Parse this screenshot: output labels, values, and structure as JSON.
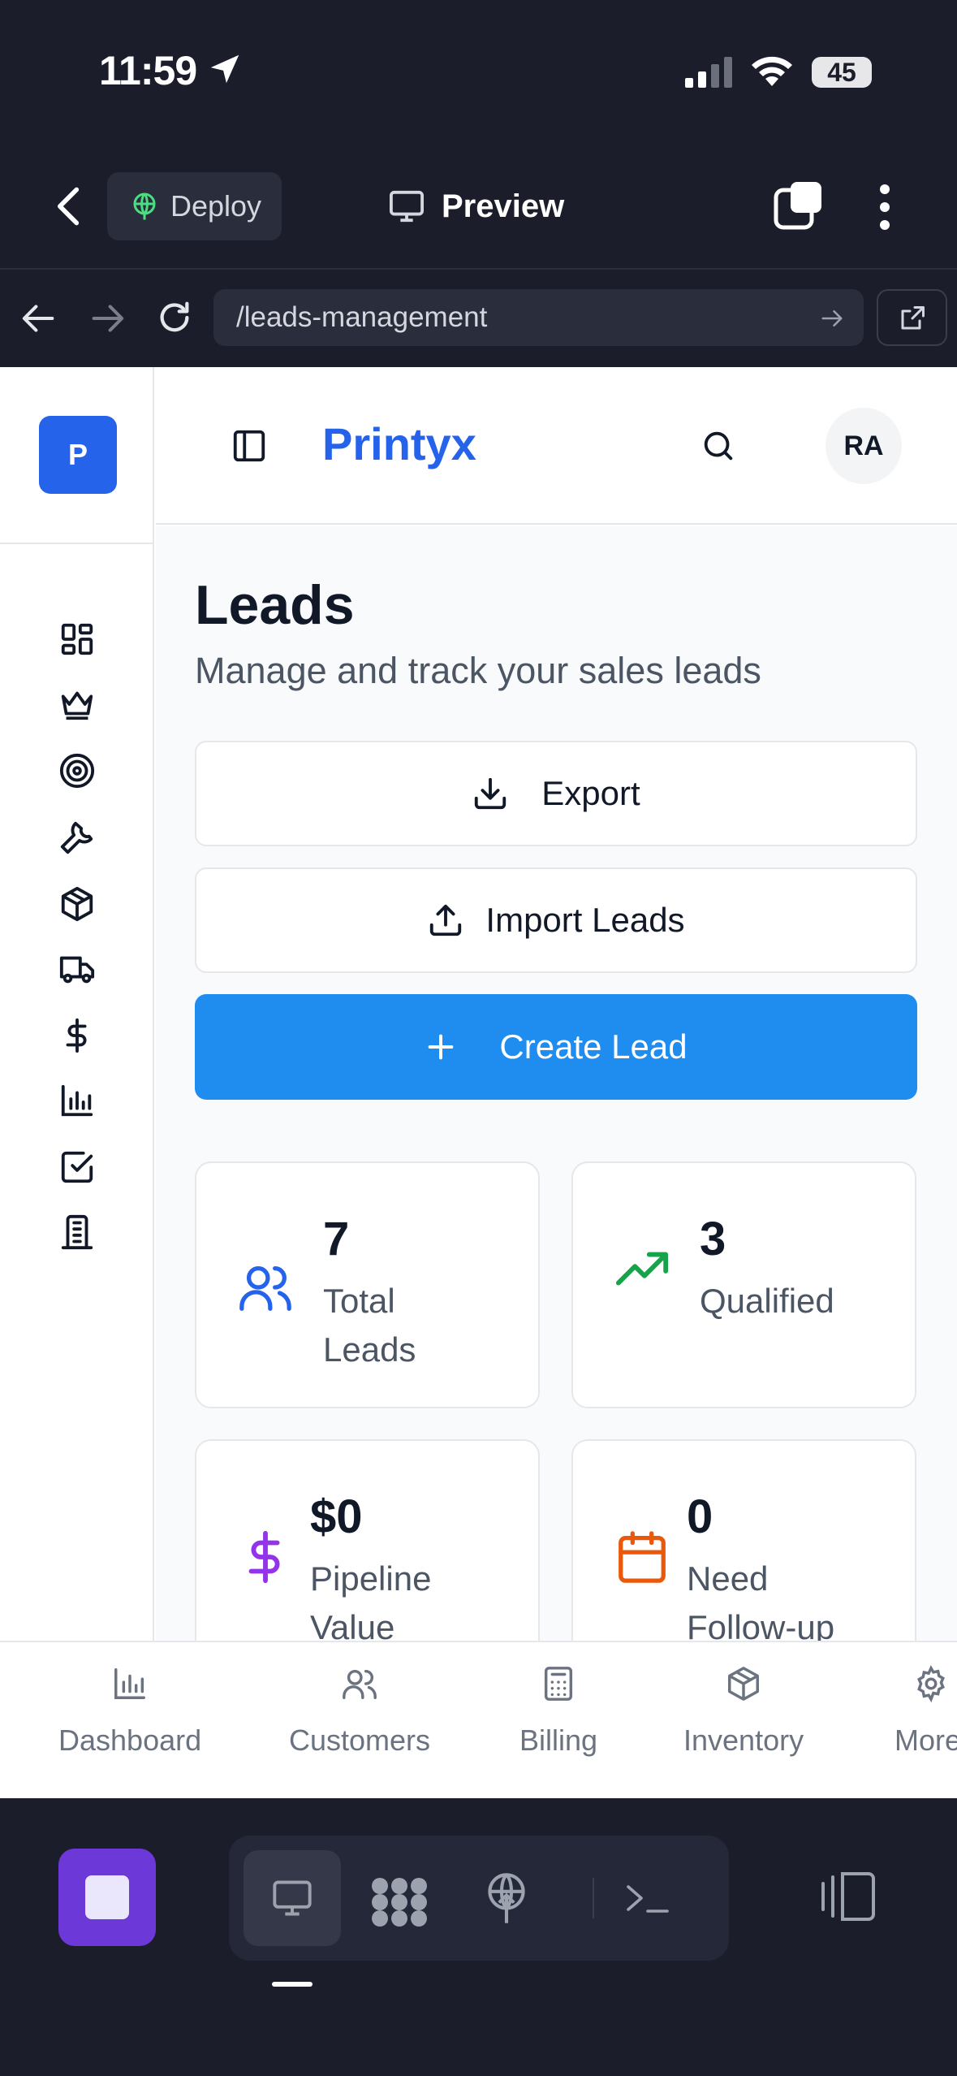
{
  "status_bar": {
    "time": "11:59",
    "battery": "45"
  },
  "app_header": {
    "deploy_label": "Deploy",
    "preview_label": "Preview"
  },
  "browser": {
    "url": "/leads-management"
  },
  "site": {
    "logo_letter": "P",
    "brand": "Printyx",
    "avatar_initials": "RA",
    "rail_icons": [
      "dashboard-grid-icon",
      "crown-icon",
      "target-icon",
      "wrench-icon",
      "package-icon",
      "truck-icon",
      "dollar-icon",
      "bar-chart-icon",
      "checkbox-icon",
      "building-icon"
    ]
  },
  "leads": {
    "title": "Leads",
    "subtitle": "Manage and track your sales leads",
    "export_label": "Export",
    "import_label": "Import Leads",
    "create_label": "Create Lead",
    "stats": [
      {
        "value": "7",
        "label": "Total Leads",
        "icon": "users-icon",
        "color": "#2563eb"
      },
      {
        "value": "3",
        "label": "Qualified",
        "icon": "trending-up-icon",
        "color": "#16a34a"
      },
      {
        "value": "$0",
        "label": "Pipeline Value",
        "icon": "dollar-icon",
        "color": "#9333ea"
      },
      {
        "value": "0",
        "label": "Need Follow-up",
        "icon": "calendar-icon",
        "color": "#ea580c"
      }
    ]
  },
  "tabbar": {
    "items": [
      {
        "label": "Dashboard",
        "icon": "bar-chart-icon"
      },
      {
        "label": "Customers",
        "icon": "users-icon"
      },
      {
        "label": "Billing",
        "icon": "calculator-icon"
      },
      {
        "label": "Inventory",
        "icon": "package-icon"
      },
      {
        "label": "More",
        "icon": "gear-icon"
      }
    ]
  },
  "colors": {
    "primary": "#2563eb",
    "create_button": "#1f8cf0",
    "dark_chrome": "#1b1d2b",
    "stop_button": "#6d38d8"
  }
}
